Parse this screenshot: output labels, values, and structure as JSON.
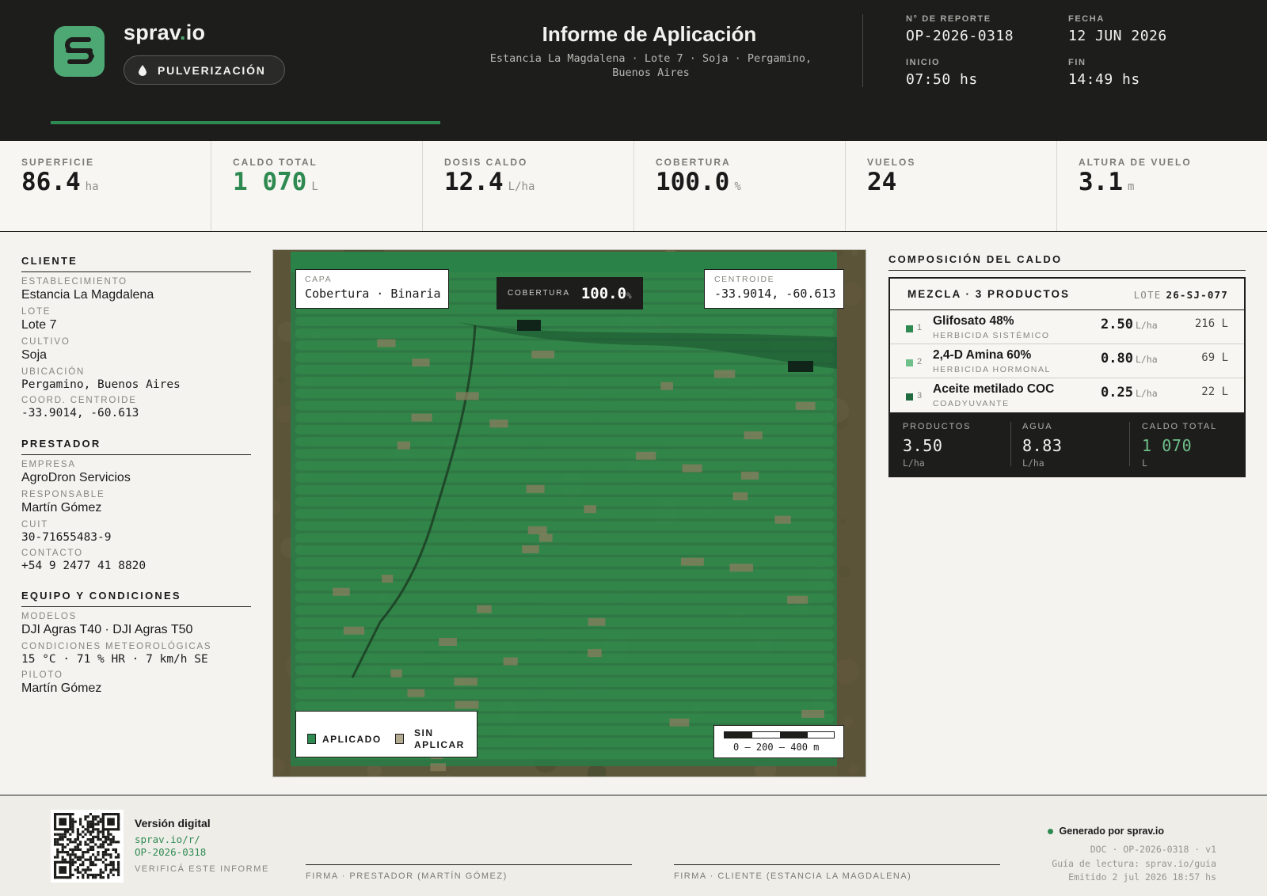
{
  "header": {
    "brand_name": "sprav",
    "brand_dot": ".",
    "brand_tld": "io",
    "mode_label": "PULVERIZACIÓN",
    "title": "Informe de Aplicación",
    "subtitle": "Estancia La Magdalena · Lote 7 · Soja · Pergamino, Buenos Aires",
    "report_no_label": "N° DE REPORTE",
    "report_no": "OP-2026-0318",
    "date_label": "FECHA",
    "date": "12 JUN 2026",
    "start_label": "INICIO",
    "start": "07:50 hs",
    "end_label": "FIN",
    "end": "14:49 hs"
  },
  "kpis": [
    {
      "label": "SUPERFICIE",
      "value": "86.4",
      "unit": "ha"
    },
    {
      "label": "CALDO TOTAL",
      "value": "1 070",
      "unit": "L"
    },
    {
      "label": "DOSIS CALDO",
      "value": "12.4",
      "unit": "L/ha"
    },
    {
      "label": "COBERTURA",
      "value": "100.0",
      "unit": "%"
    },
    {
      "label": "VUELOS",
      "value": "24",
      "unit": ""
    },
    {
      "label": "ALTURA DE VUELO",
      "value": "3.1",
      "unit": "m"
    }
  ],
  "cliente": {
    "title": "CLIENTE",
    "establecimiento_label": "ESTABLECIMIENTO",
    "establecimiento": "Estancia La Magdalena",
    "lote_label": "LOTE",
    "lote": "Lote 7",
    "cultivo_label": "CULTIVO",
    "cultivo": "Soja",
    "ubicacion_label": "UBICACIÓN",
    "ubicacion": "Pergamino, Buenos Aires",
    "coord_label": "COORD. CENTROIDE",
    "coord": "-33.9014, -60.613"
  },
  "prestador": {
    "title": "PRESTADOR",
    "empresa_label": "EMPRESA",
    "empresa": "AgroDron Servicios",
    "responsable_label": "RESPONSABLE",
    "responsable": "Martín Gómez",
    "cuit_label": "CUIT",
    "cuit": "30-71655483-9",
    "contacto_label": "CONTACTO",
    "contacto": "+54 9 2477 41 8820"
  },
  "equipo": {
    "title": "EQUIPO Y CONDICIONES",
    "modelos_label": "MODELOS",
    "modelos": "DJI Agras T40 · DJI Agras T50",
    "condiciones_label": "CONDICIONES METEOROLÓGICAS",
    "condiciones": "15 °C · 71 % HR · 7 km/h SE",
    "piloto_label": "PILOTO",
    "piloto": "Martín Gómez"
  },
  "map": {
    "layer_label": "CAPA",
    "layer_value": "Cobertura · Binaria",
    "coverage_label": "COBERTURA",
    "coverage_value": "100.0",
    "coverage_unit": "%",
    "centroid_label": "CENTROIDE",
    "centroid_value": "-33.9014, -60.613",
    "legend_applied": "APLICADO",
    "legend_not_applied_1": "SIN",
    "legend_not_applied_2": "APLICAR",
    "scale_text": "0 — 200 — 400 m",
    "colors": {
      "applied": "#2f8a52",
      "not_applied": "#b3aa92"
    }
  },
  "composicion": {
    "title": "COMPOSICIÓN DEL CALDO",
    "mix_label": "MEZCLA · 3 PRODUCTOS",
    "lote_label": "LOTE",
    "lote_value": "26-SJ-077",
    "products": [
      {
        "n": "1",
        "name": "Glifosato 48%",
        "category": "HERBICIDA SISTÉMICO",
        "dose": "2.50",
        "dose_unit": "L/ha",
        "total": "216 L",
        "color": "#2f8a52"
      },
      {
        "n": "2",
        "name": "2,4-D Amina 60%",
        "category": "HERBICIDA HORMONAL",
        "dose": "0.80",
        "dose_unit": "L/ha",
        "total": "69 L",
        "color": "#6fbf8a"
      },
      {
        "n": "3",
        "name": "Aceite metilado COC",
        "category": "COADYUVANTE",
        "dose": "0.25",
        "dose_unit": "L/ha",
        "total": "22 L",
        "color": "#1f6b3e"
      }
    ],
    "totals": {
      "productos_label": "PRODUCTOS",
      "productos_value": "3.50",
      "productos_unit": "L/ha",
      "agua_label": "AGUA",
      "agua_value": "8.83",
      "agua_unit": "L/ha",
      "caldo_label": "CALDO TOTAL",
      "caldo_value": "1 070",
      "caldo_unit": "L"
    }
  },
  "footer": {
    "digital_title": "Versión digital",
    "digital_link_1": "sprav.io/r/",
    "digital_link_2": "OP-2026-0318",
    "verify": "VERIFICÁ ESTE INFORME",
    "sig_prestador": "FIRMA · PRESTADOR (MARTÍN GÓMEZ)",
    "sig_cliente": "FIRMA · CLIENTE (ESTANCIA LA MAGDALENA)",
    "generated": "Generado por sprav.io",
    "doc_line": "DOC · OP-2026-0318 · v1",
    "guide_line": "Guía de lectura: sprav.io/guia",
    "issued_line": "Emitido 2 jul 2026 18:57 hs"
  }
}
